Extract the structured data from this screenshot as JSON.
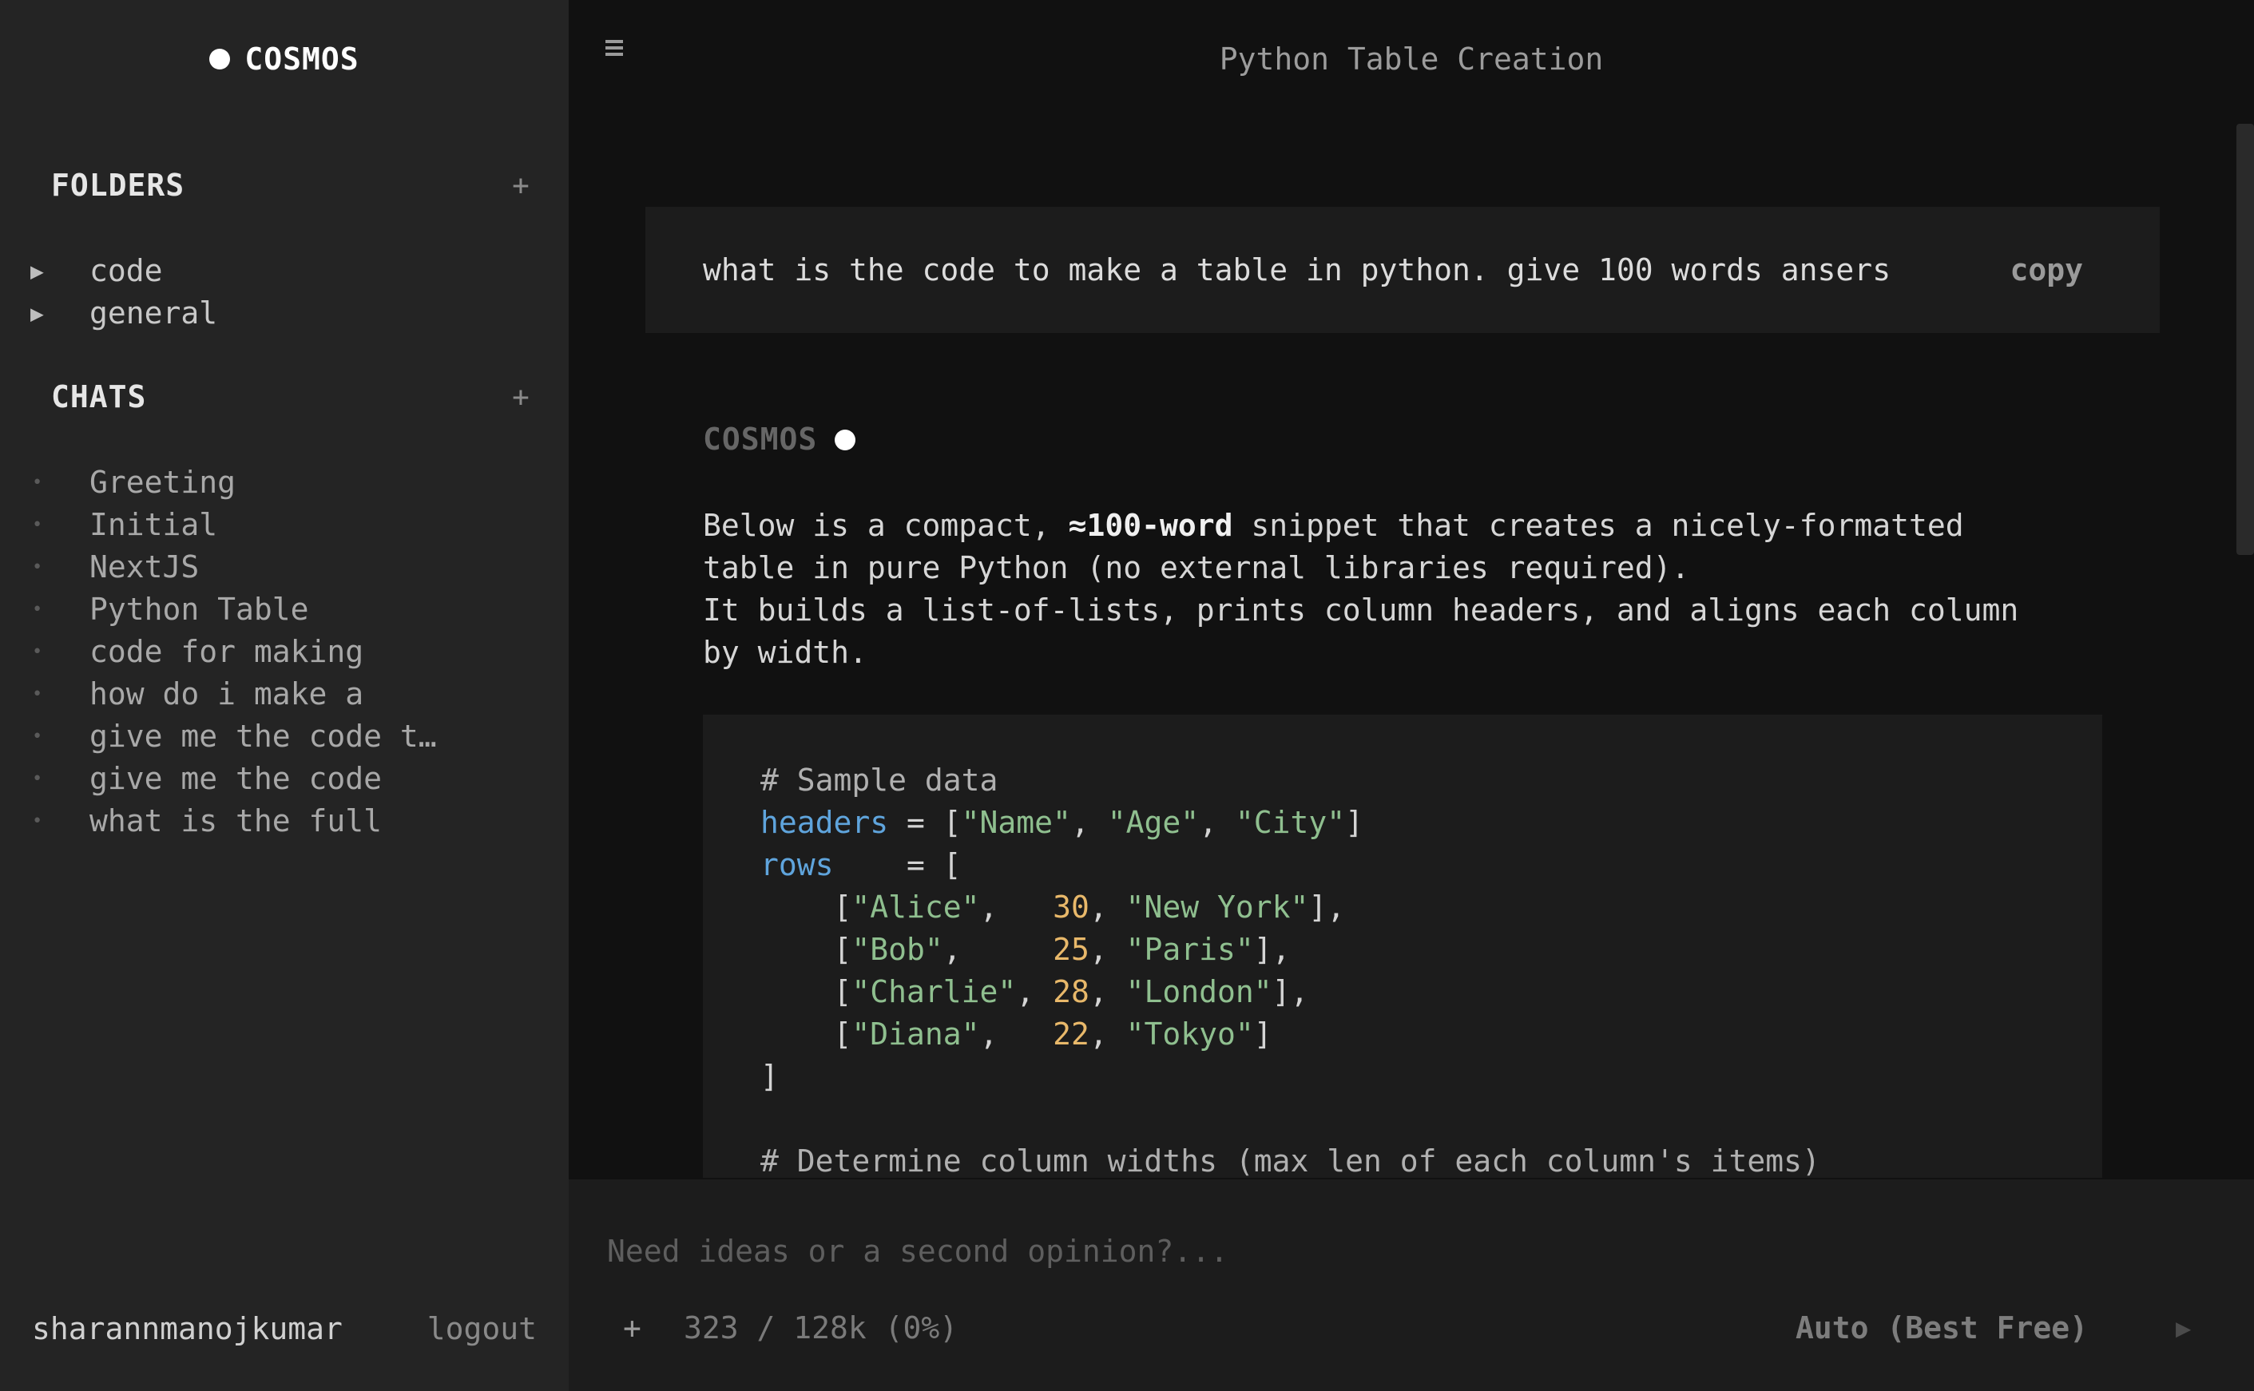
{
  "brand": {
    "name": "COSMOS"
  },
  "sidebar": {
    "folders_title": "FOLDERS",
    "folders_add": "+",
    "folders": [
      {
        "label": "code"
      },
      {
        "label": "general"
      }
    ],
    "chats_title": "CHATS",
    "chats_add": "+",
    "chats": [
      {
        "label": "Greeting"
      },
      {
        "label": "Initial"
      },
      {
        "label": "NextJS"
      },
      {
        "label": "Python Table"
      },
      {
        "label": "code for making"
      },
      {
        "label": "how do i make a"
      },
      {
        "label": "give me the code t…"
      },
      {
        "label": "give me the code"
      },
      {
        "label": "what is the full"
      }
    ],
    "username": "sharannmanojkumar",
    "logout": "logout"
  },
  "header": {
    "title": "Python Table Creation"
  },
  "conversation": {
    "user_message": "what is the code to make a table in python. give 100 words ansers",
    "copy_label": "copy",
    "assistant_name": "COSMOS",
    "answer": {
      "p1_before": "Below is a compact, ",
      "p1_bold": "≈100-word",
      "p1_after": " snippet that creates a nicely-formatted",
      "p2": "table in pure Python (no external libraries required).",
      "p3": "It builds a list-of-lists, prints column headers, and aligns each column",
      "p4": "by width."
    },
    "code": {
      "comment1": "# Sample data",
      "headers_var": "headers",
      "headers_eq": " = [",
      "headers_values": [
        "\"Name\"",
        "\"Age\"",
        "\"City\""
      ],
      "rows_var": "rows",
      "rows_eq": "    = [",
      "rows": [
        {
          "name": "\"Alice\"",
          "pad": "   ",
          "age": "30",
          "city": "\"New York\"",
          "end": "],"
        },
        {
          "name": "\"Bob\"",
          "pad": "     ",
          "age": "25",
          "city": "\"Paris\"",
          "end": "],"
        },
        {
          "name": "\"Charlie\"",
          "pad": " ",
          "age": "28",
          "city": "\"London\"",
          "end": "],"
        },
        {
          "name": "\"Diana\"",
          "pad": "   ",
          "age": "22",
          "city": "\"Tokyo\"",
          "end": "]"
        }
      ],
      "close": "]",
      "comment2": "# Determine column widths (max len of each column's items)"
    }
  },
  "composer": {
    "placeholder": "Need ideas or a second opinion?...",
    "attach": "+",
    "token_count": "323 / 128k (0%)",
    "model": "Auto (Best Free)",
    "send": "▶"
  }
}
